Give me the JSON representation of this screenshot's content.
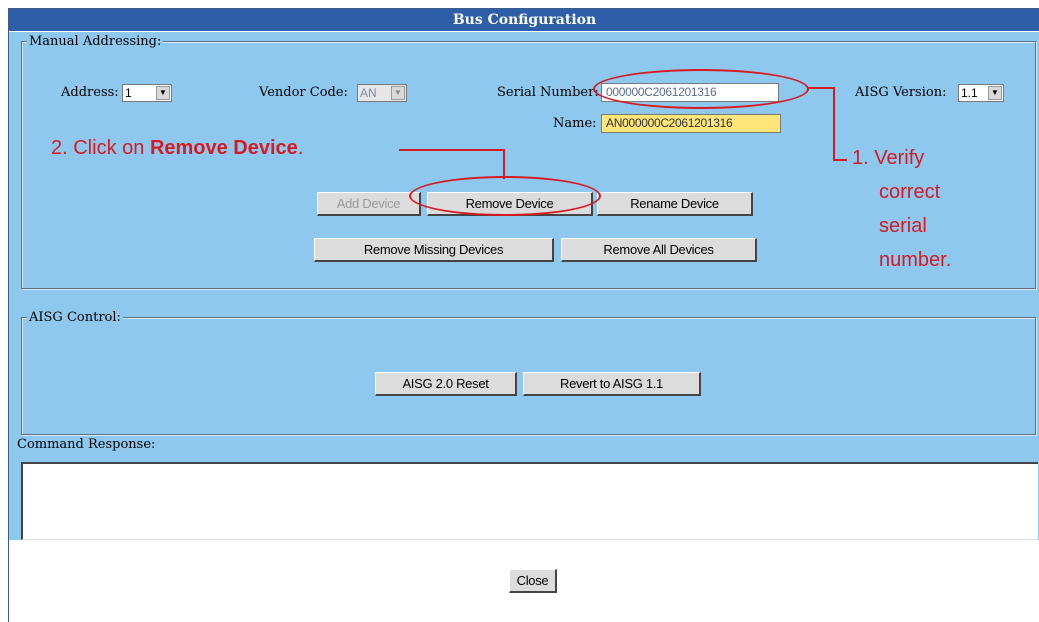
{
  "window": {
    "title": "Bus Configuration"
  },
  "manual_addressing": {
    "legend": "Manual Addressing:",
    "address_label": "Address:",
    "address_value": "1",
    "vendor_code_label": "Vendor Code:",
    "vendor_code_value": "AN",
    "serial_number_label": "Serial Number:",
    "serial_number_value": "000000C2061201316",
    "aisg_version_label": "AISG Version:",
    "aisg_version_value": "1.1",
    "name_label": "Name:",
    "name_value": "AN000000C2061201316",
    "buttons": {
      "add_device": "Add Device",
      "remove_device": "Remove Device",
      "rename_device": "Rename Device",
      "remove_missing_devices": "Remove Missing Devices",
      "remove_all_devices": "Remove All Devices"
    }
  },
  "aisg_control": {
    "legend": "AISG Control:",
    "buttons": {
      "aisg_reset": "AISG 2.0 Reset",
      "revert": "Revert to AISG 1.1"
    }
  },
  "command_response": {
    "label": "Command Response:",
    "value": ""
  },
  "footer": {
    "close": "Close"
  },
  "annotations": {
    "step2_prefix": "2. Click on ",
    "step2_bold": "Remove Device",
    "step2_suffix": ".",
    "step1_lines": [
      "1. Verify",
      "correct",
      "serial",
      "number."
    ]
  },
  "colors": {
    "title_bar": "#2f5ea8",
    "panel": "#8ec8ee",
    "annotation_red": "#d71920",
    "name_field_bg": "#ffe57a"
  }
}
